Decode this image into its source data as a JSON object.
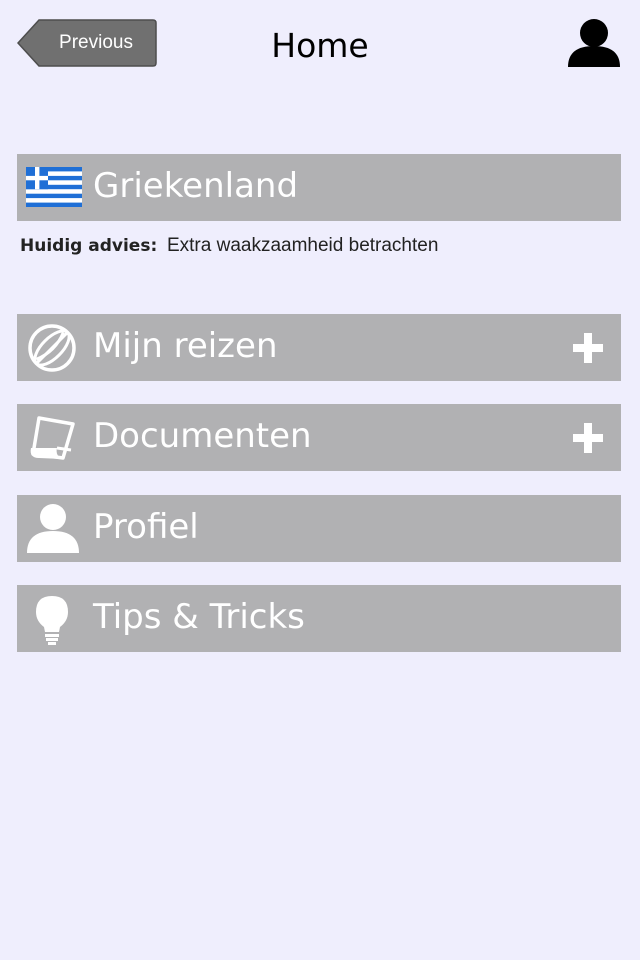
{
  "header": {
    "back_label": "Previous",
    "title": "Home",
    "profile_icon": "person-icon"
  },
  "country": {
    "name": "Griekenland",
    "flag_icon": "greece-flag-icon",
    "advice_label": "Huidig advies:",
    "advice_value": "Extra waakzaamheid betrachten"
  },
  "menu": [
    {
      "label": "Mijn reizen",
      "icon": "globe-icon",
      "has_add": true
    },
    {
      "label": "Documenten",
      "icon": "document-icon",
      "has_add": true
    },
    {
      "label": "Profiel",
      "icon": "person-icon",
      "has_add": false
    },
    {
      "label": "Tips & Tricks",
      "icon": "lightbulb-icon",
      "has_add": false
    }
  ],
  "colors": {
    "background": "#efeefd",
    "bar": "#b1b1b3",
    "back_button": "#6f6f6f",
    "flag_blue": "#1f6fd6"
  }
}
